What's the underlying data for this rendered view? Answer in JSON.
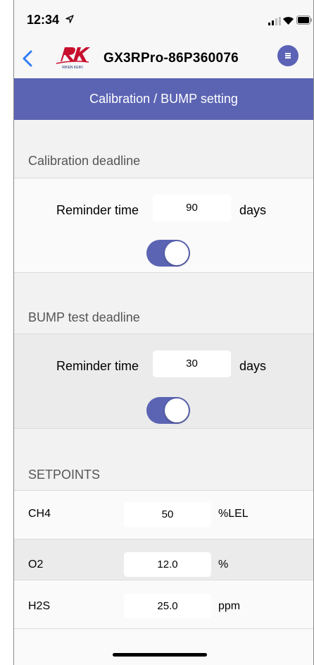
{
  "status_bar": {
    "time": "12:34"
  },
  "nav": {
    "device_title": "GX3RPro-86P360076",
    "logo_text": "RIKEN KEIKI"
  },
  "header": {
    "title": "Calibration / BUMP setting"
  },
  "calibration": {
    "heading": "Calibration deadline",
    "reminder_label": "Reminder time",
    "reminder_value": "90",
    "unit": "days",
    "enabled": true
  },
  "bump": {
    "heading": "BUMP test deadline",
    "reminder_label": "Reminder time",
    "reminder_value": "30",
    "unit": "days",
    "enabled": true
  },
  "setpoints": {
    "heading": "SETPOINTS",
    "rows": [
      {
        "gas": "CH4",
        "value": "50",
        "unit": "%LEL"
      },
      {
        "gas": "O2",
        "value": "12.0",
        "unit": "%"
      },
      {
        "gas": "H2S",
        "value": "25.0",
        "unit": "ppm"
      }
    ]
  },
  "colors": {
    "accent": "#5b64b3",
    "logo_red": "#c8102e"
  },
  "icons": [
    "location-arrow-icon",
    "signal-icon",
    "wifi-icon",
    "battery-icon",
    "back-chevron-icon",
    "menu-icon"
  ]
}
